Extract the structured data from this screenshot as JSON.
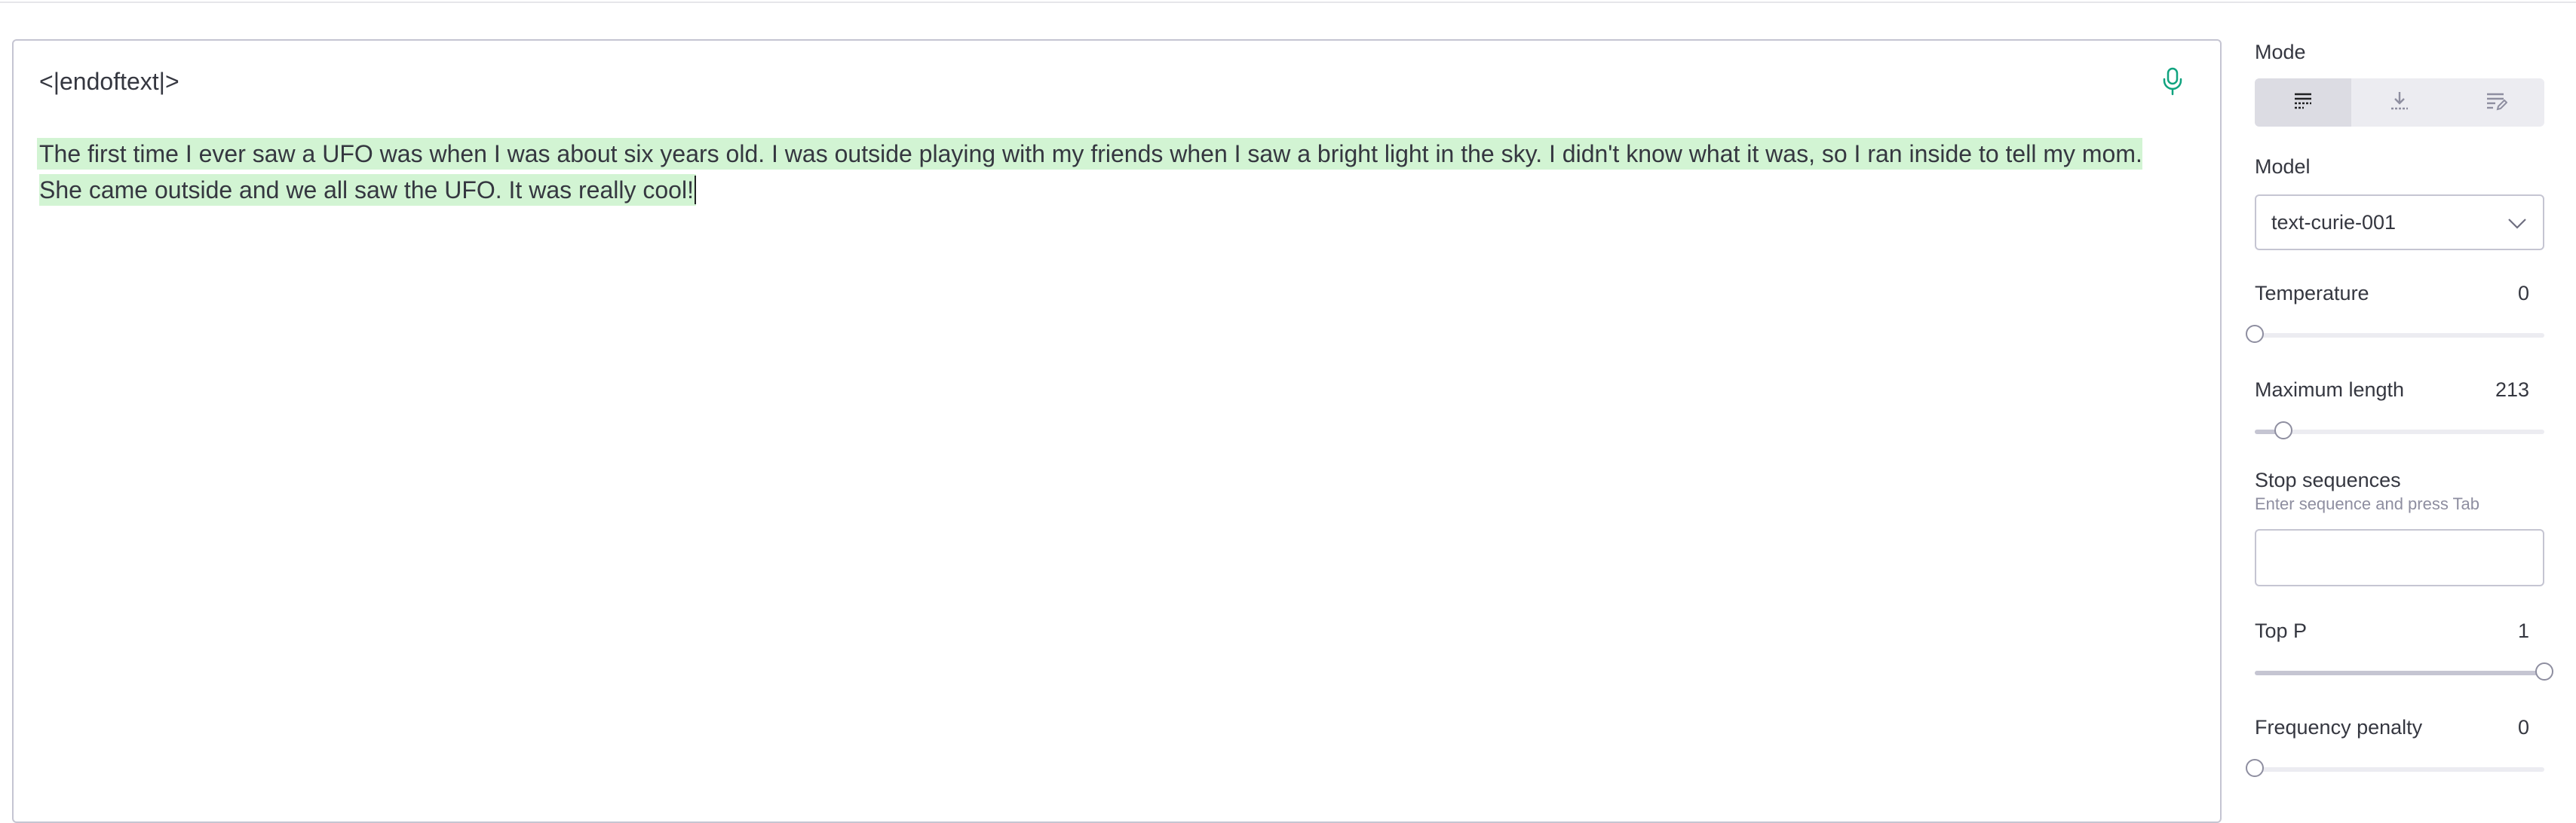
{
  "editor": {
    "prompt_text": "<|endoftext|>",
    "completion_text": "The first time I ever saw a UFO was when I was about six years old. I was outside playing with my friends when I saw a bright light in the sky. I didn't know what it was, so I ran inside to tell my mom. She came outside and we all saw the UFO. It was really cool!",
    "mic_icon": "microphone-icon",
    "highlight_color": "#d2f4d3",
    "mic_color": "#10a37f"
  },
  "sidebar": {
    "mode": {
      "label": "Mode",
      "options": [
        {
          "icon": "complete-mode-icon",
          "active": true
        },
        {
          "icon": "insert-mode-icon",
          "active": false
        },
        {
          "icon": "edit-mode-icon",
          "active": false
        }
      ]
    },
    "model": {
      "label": "Model",
      "value": "text-curie-001"
    },
    "temperature": {
      "label": "Temperature",
      "value": "0",
      "fraction": 0
    },
    "max_length": {
      "label": "Maximum length",
      "value": "213",
      "fraction": 0.1
    },
    "stop_sequences": {
      "label": "Stop sequences",
      "hint": "Enter sequence and press Tab",
      "value": ""
    },
    "top_p": {
      "label": "Top P",
      "value": "1",
      "fraction": 1
    },
    "frequency_penalty": {
      "label": "Frequency penalty",
      "value": "0",
      "fraction": 0
    }
  }
}
